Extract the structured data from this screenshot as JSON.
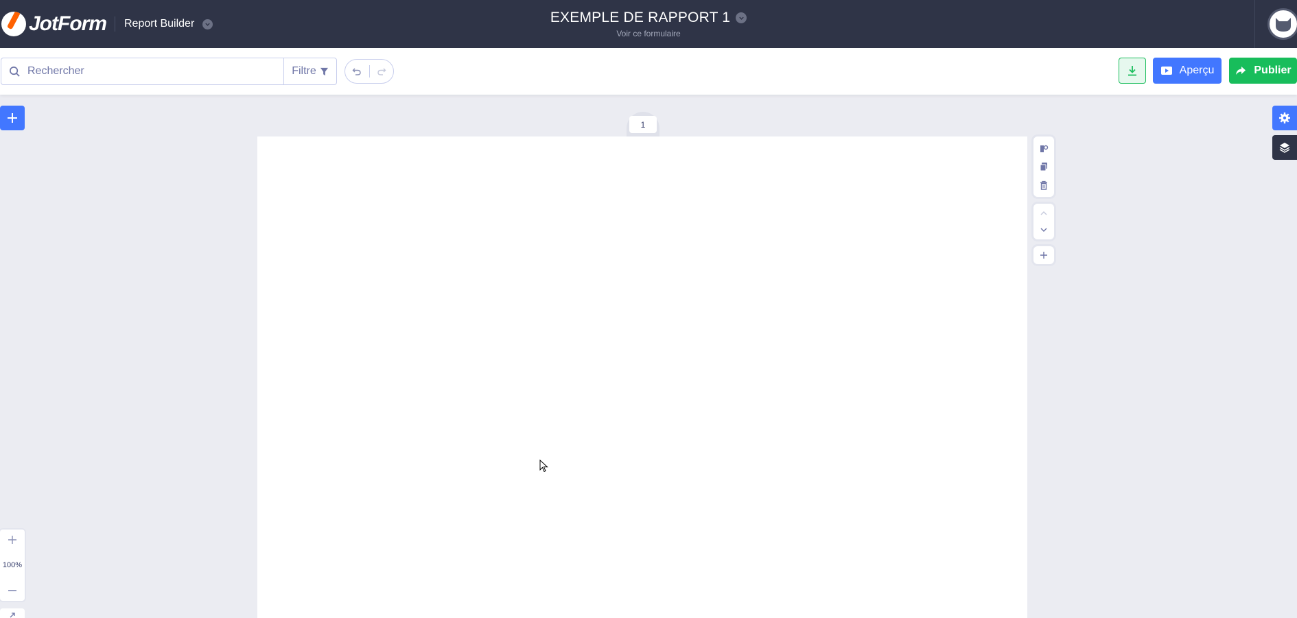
{
  "navbar": {
    "logo_text": "JotForm",
    "app_switcher_label": "Report Builder",
    "report_title": "EXEMPLE DE RAPPORT 1",
    "report_subtitle": "Voir ce formulaire"
  },
  "toolbar": {
    "search_placeholder": "Rechercher",
    "filter_label": "Filtre",
    "preview_label": "Aperçu",
    "publish_label": "Publier"
  },
  "canvas": {
    "page_number": "1",
    "zoom_level": "100%"
  },
  "colors": {
    "navbar_bg": "#2f3447",
    "primary_blue": "#4277ff",
    "publish_green": "#18bd5b",
    "workspace_bg": "#ebecf2"
  },
  "icons": {
    "search": "search-icon",
    "filter": "filter-icon",
    "undo": "undo-icon",
    "redo": "redo-icon",
    "download": "download-icon",
    "preview": "play-icon",
    "publish": "share-arrow-icon",
    "add": "plus-icon",
    "settings": "gear-icon",
    "layers": "layers-icon"
  }
}
